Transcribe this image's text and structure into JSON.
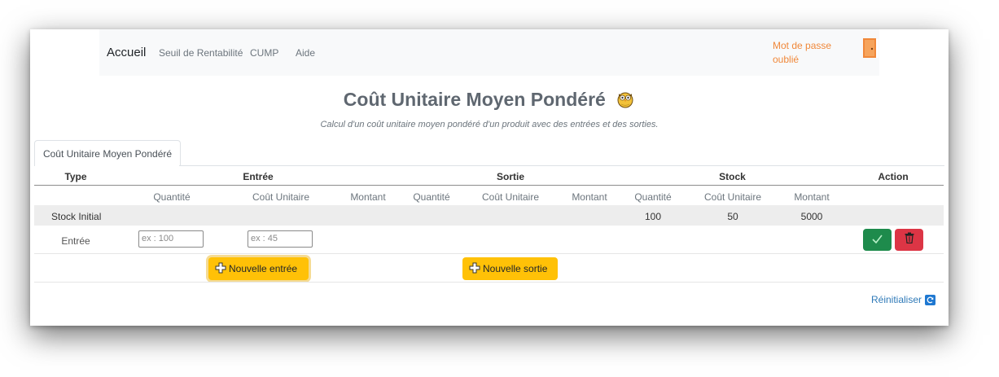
{
  "navbar": {
    "brand": "Accueil",
    "links": [
      "Seuil de Rentabilité",
      "CUMP",
      "Aide"
    ],
    "forgot_password": "Mot de passe oublié",
    "door_icon": "door-exit-icon"
  },
  "page": {
    "title": "Coût Unitaire Moyen Pondéré",
    "subtitle": "Calcul d'un coût unitaire moyen pondéré d'un produit avec des entrées et des sorties."
  },
  "tab": {
    "label": "Coût Unitaire Moyen Pondéré"
  },
  "table": {
    "groups": {
      "type": "Type",
      "entree": "Entrée",
      "sortie": "Sortie",
      "stock": "Stock",
      "action": "Action"
    },
    "subheaders": [
      "Quantité",
      "Coût Unitaire",
      "Montant",
      "Quantité",
      "Coût Unitaire",
      "Montant",
      "Quantité",
      "Coût Unitaire",
      "Montant"
    ],
    "stock_initial": {
      "type": "Stock Initial",
      "stock_quantite": "100",
      "stock_cout": "50",
      "stock_montant": "5000"
    },
    "entry_row": {
      "type": "Entrée",
      "quantite_placeholder": "ex : 100",
      "cout_placeholder": "ex : 45"
    }
  },
  "buttons": {
    "nouvelle_entree": "Nouvelle entrée",
    "nouvelle_sortie": "Nouvelle sortie",
    "reinitialiser": "Réinitialiser"
  },
  "colors": {
    "navbar_bg": "#f8f9fa",
    "accent_orange": "#f0883a",
    "warning": "#ffc107",
    "success": "#1e8b4c",
    "danger": "#dc3545",
    "link": "#2f7ab8"
  }
}
